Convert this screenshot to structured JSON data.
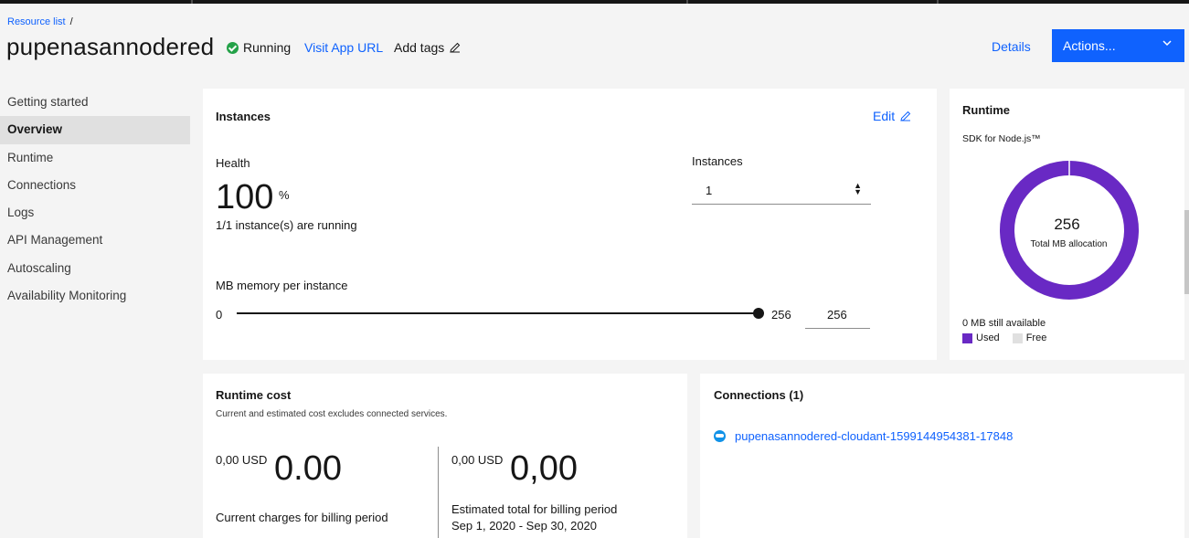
{
  "breadcrumb": {
    "link": "Resource list",
    "separator": "/"
  },
  "header": {
    "title": "pupenasannodered",
    "status": "Running",
    "visit_app_url": "Visit App URL",
    "add_tags": "Add tags",
    "details": "Details",
    "actions": "Actions..."
  },
  "sidebar": {
    "items": [
      {
        "label": "Getting started"
      },
      {
        "label": "Overview"
      },
      {
        "label": "Runtime"
      },
      {
        "label": "Connections"
      },
      {
        "label": "Logs"
      },
      {
        "label": "API Management"
      },
      {
        "label": "Autoscaling"
      },
      {
        "label": "Availability Monitoring"
      }
    ],
    "active_index": 1
  },
  "instances_card": {
    "title": "Instances",
    "edit": "Edit",
    "health_label": "Health",
    "health_value": "100",
    "health_unit": "%",
    "running_text": "1/1 instance(s) are running",
    "instances_label": "Instances",
    "instances_value": "1",
    "memory_label": "MB memory per instance",
    "slider_min": "0",
    "slider_max": "256",
    "memory_value": "256",
    "slider_fraction": 1.0
  },
  "runtime_card": {
    "title": "Runtime",
    "sdk": "SDK for Node.js™",
    "total": "256",
    "total_label": "Total MB allocation",
    "available": "0 MB still available",
    "legend": {
      "used": "Used",
      "free": "Free"
    },
    "used_mb": 256,
    "free_mb": 0,
    "colors": {
      "used": "#6929c4",
      "free": "#e0e0e0"
    }
  },
  "cost_card": {
    "title": "Runtime cost",
    "subtitle": "Current and estimated cost excludes connected services.",
    "current": {
      "small": "0,00 USD",
      "big": "0.00",
      "label": "Current charges for billing period"
    },
    "estimated": {
      "small": "0,00 USD",
      "big": "0,00",
      "label": "Estimated total for billing period",
      "range": "Sep 1, 2020 - Sep 30, 2020"
    }
  },
  "connections_card": {
    "title": "Connections (1)",
    "items": [
      {
        "label": "pupenasannodered-cloudant-1599144954381-17848"
      }
    ]
  },
  "colors": {
    "accent": "#0f62fe",
    "status_ok": "#24a148"
  }
}
